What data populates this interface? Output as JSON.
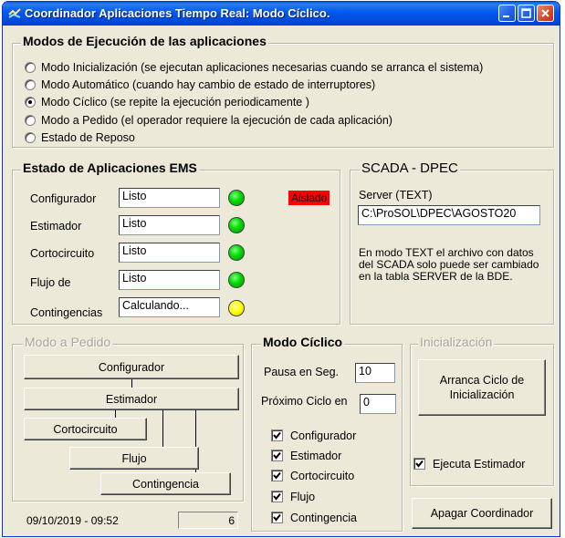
{
  "window": {
    "title": "Coordinador Aplicaciones Tiempo Real: Modo Cíclico."
  },
  "modes": {
    "title": "Modos de Ejecución de las aplicaciones",
    "options": [
      {
        "label": "Modo Inicialización (se ejecutan aplicaciones necesarias cuando se arranca el sistema)",
        "checked": false
      },
      {
        "label": "Modo Automático (cuando hay cambio de estado de interruptores)",
        "checked": false
      },
      {
        "label": "Modo Cíclico (se repite la ejecución periodicamente )",
        "checked": true
      },
      {
        "label": "Modo a Pedido (el operador requiere la ejecución de cada aplicación)",
        "checked": false
      },
      {
        "label": "Estado de Reposo",
        "checked": false
      }
    ]
  },
  "ems": {
    "title": "Estado de Aplicaciones EMS",
    "aislado": "Aislado",
    "rows": [
      {
        "label": "Configurador",
        "value": "Listo",
        "light": "green"
      },
      {
        "label": "Estimador",
        "value": "Listo",
        "light": "green"
      },
      {
        "label": "Cortocircuito",
        "value": "Listo",
        "light": "green"
      },
      {
        "label": "Flujo de",
        "value": "Listo",
        "light": "green"
      },
      {
        "label": "Contingencias",
        "value": "Calculando...",
        "light": "yellow"
      }
    ]
  },
  "scada": {
    "title": "SCADA - DPEC",
    "server_label": "Server (TEXT)",
    "server_value": "C:\\ProSOL\\DPEC\\AGOSTO20",
    "note": "En modo TEXT el archivo con datos del SCADA solo puede ser cambiado en la tabla SERVER de la BDE."
  },
  "pedido": {
    "title": "Modo a Pedido",
    "buttons": {
      "configurador": "Configurador",
      "estimador": "Estimador",
      "cortocircuito": "Cortocircuito",
      "flujo": "Flujo",
      "contingencia": "Contingencia"
    }
  },
  "ciclico": {
    "title": "Modo Cíclico",
    "pausa_label": "Pausa en Seg.",
    "pausa_value": "10",
    "proximo_label": "Próximo Ciclo en",
    "proximo_value": "0",
    "checks": [
      {
        "label": "Configurador",
        "checked": true
      },
      {
        "label": "Estimador",
        "checked": true
      },
      {
        "label": "Cortocircuito",
        "checked": true
      },
      {
        "label": "Flujo",
        "checked": true
      },
      {
        "label": "Contingencia",
        "checked": true
      }
    ]
  },
  "inicializacion": {
    "title": "Inicialización",
    "arranca_button": "Arranca Ciclo de Inicialización",
    "ejecuta_label": "Ejecuta Estimador",
    "ejecuta_checked": true
  },
  "footer": {
    "datetime": "09/10/2019 - 09:52",
    "counter": "6",
    "apagar_button": "Apagar Coordinador"
  },
  "colors": {
    "titlebar": "#0058ee",
    "aislado": "#ff0000",
    "light_green": "#00d800",
    "light_yellow": "#ffff00"
  }
}
